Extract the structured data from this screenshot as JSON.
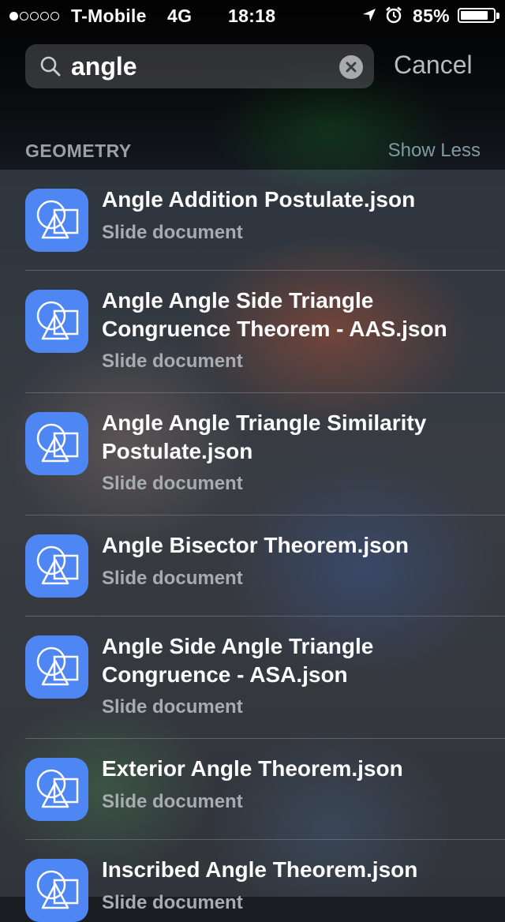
{
  "status_bar": {
    "carrier": "T-Mobile",
    "network": "4G",
    "time": "18:18",
    "battery": "85%",
    "battery_level": 0.85,
    "signal_bars_filled": 1,
    "signal_bars_total": 5
  },
  "search": {
    "query": "angle",
    "cancel_label": "Cancel"
  },
  "section": {
    "title": "GEOMETRY",
    "toggle_label": "Show Less"
  },
  "results": [
    {
      "title": "Angle Addition Postulate.json",
      "subtitle": "Slide document"
    },
    {
      "title": "Angle Angle Side Triangle Congruence Theorem - AAS.json",
      "subtitle": "Slide document"
    },
    {
      "title": "Angle Angle Triangle Similarity Postulate.json",
      "subtitle": "Slide document"
    },
    {
      "title": "Angle Bisector Theorem.json",
      "subtitle": "Slide document"
    },
    {
      "title": "Angle Side Angle Triangle Congruence - ASA.json",
      "subtitle": "Slide document"
    },
    {
      "title": "Exterior Angle Theorem.json",
      "subtitle": "Slide document"
    },
    {
      "title": "Inscribed Angle Theorem.json",
      "subtitle": "Slide document"
    }
  ],
  "colors": {
    "app_icon": "#4e86f3",
    "accent_muted": "#7f9aa0"
  },
  "icons": {
    "app_icon": "geometry-shapes-icon",
    "search": "search-icon",
    "clear": "clear-icon",
    "location": "location-arrow-icon",
    "alarm": "alarm-clock-icon"
  }
}
